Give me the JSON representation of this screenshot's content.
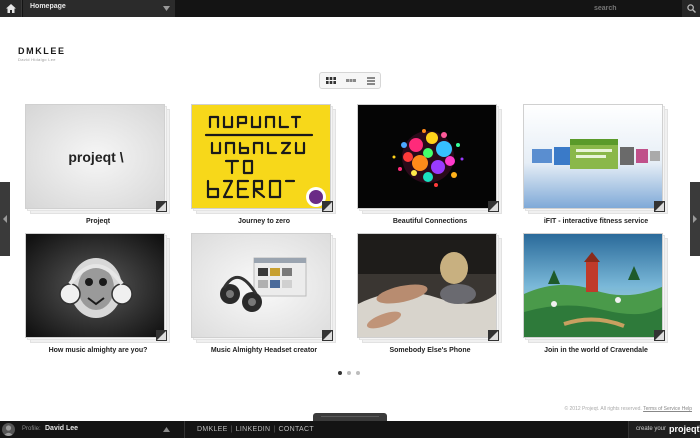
{
  "topbar": {
    "home_icon": "home-icon",
    "page_select_value": "Homepage",
    "search_placeholder": "search",
    "search_icon": "search-icon"
  },
  "logo": {
    "title": "DMKLEE",
    "subtitle": "David Hidalgo Lee"
  },
  "view_switch": {
    "options": [
      "grid-view-icon",
      "list-view-icon",
      "detail-view-icon"
    ],
    "selected": "grid-view-icon"
  },
  "projects": [
    {
      "title": "Projeqt"
    },
    {
      "title": "Journey to zero"
    },
    {
      "title": "Beautiful Connections"
    },
    {
      "title": "iFIT - interactive fitness service"
    },
    {
      "title": "How music almighty are you?"
    },
    {
      "title": "Music Almighty Headset creator"
    },
    {
      "title": "Somebody Else's Phone"
    },
    {
      "title": "Join in the world of Cravendale"
    }
  ],
  "thumb_text": {
    "projeqt_logo": "projeqt \\"
  },
  "pagination": {
    "pages": 3,
    "current": 1
  },
  "footer": {
    "copyright": "© 2012 Projeqt. All rights reserved.",
    "terms_link": "Terms of Service Help"
  },
  "bottombar": {
    "profile_label": "Profile:",
    "profile_name": "David Lee",
    "links": [
      "DMKLEE",
      "LINKEDIN",
      "CONTACT"
    ],
    "create_label": "create your",
    "create_brand": "projeqt\\"
  },
  "colors": {
    "bar_background": "#141414",
    "journey_yellow": "#f7d81a"
  }
}
